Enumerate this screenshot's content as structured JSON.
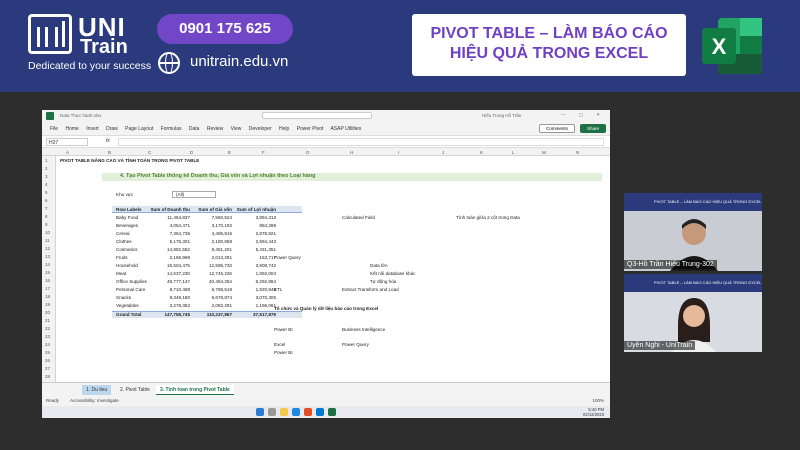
{
  "banner": {
    "brand": "UNI",
    "brand2": "Train",
    "tagline": "Dedicated to your success",
    "phone": "0901 175 625",
    "website": "unitrain.edu.vn",
    "title_line1": "PIVOT TABLE – LÀM BÁO CÁO",
    "title_line2": "HIỆU QUẢ TRONG EXCEL",
    "excel_letter": "X"
  },
  "excel": {
    "file_name": "Data Thực hành.xlsx",
    "user": "Hiếu Trung Hồ Trần",
    "window_controls": "— ▢ ✕",
    "ribbon_tabs": [
      "File",
      "Home",
      "Insert",
      "Draw",
      "Page Layout",
      "Formulas",
      "Data",
      "Review",
      "View",
      "Developer",
      "Help",
      "Power Pivot",
      "ASAP Utilities"
    ],
    "comments_label": "Comments",
    "share_label": "Share",
    "name_box": "H27",
    "fx": "fx",
    "columns": [
      "A",
      "B",
      "C",
      "D",
      "E",
      "F",
      "G",
      "H",
      "I",
      "J",
      "K",
      "L",
      "M",
      "N"
    ],
    "sheet_title": "PIVOT TABLE NÂNG CAO VÀ TÍNH TOÁN TRONG PIVOT TABLE",
    "banner_text": "4. Tạo Pivot Table thống kê Doanh thu, Giá vốn và Lợi nhuận theo Loại hàng",
    "filter_label": "Khu vực",
    "filter_value": "(All)",
    "pivot_headers": [
      "Row Labels",
      "Sum of Doanh thu",
      "Sum of Giá vốn",
      "Sum of Lợi nhuận"
    ],
    "pivot_rows": [
      [
        "Baby Food",
        "11,454,837",
        "7,560,524",
        "3,894,313"
      ],
      [
        "Beverages",
        "4,054,471",
        "3,170,182",
        "884,289"
      ],
      [
        "Cereal",
        "7,364,735",
        "4,485,915",
        "2,878,821"
      ],
      [
        "Clothes",
        "5,175,301",
        "2,180,858",
        "2,994,443"
      ],
      [
        "Cosmetics",
        "14,882,552",
        "9,451,201",
        "5,431,351"
      ],
      [
        "Fruits",
        "2,166,998",
        "2,013,281",
        "153,717"
      ],
      [
        "Household",
        "16,504,475",
        "12,595,733",
        "3,908,742"
      ],
      [
        "Meat",
        "14,637,230",
        "12,745,226",
        "1,892,004"
      ],
      [
        "Office Supplies",
        "49,777,147",
        "40,484,264",
        "9,292,884"
      ],
      [
        "Personal Care",
        "8,710,488",
        "6,789,519",
        "1,920,949"
      ],
      [
        "Snacks",
        "9,349,180",
        "6,678,874",
        "3,070,305"
      ],
      [
        "Vegetables",
        "3,278,352",
        "2,082,291",
        "1,196,061"
      ]
    ],
    "pivot_total": [
      "Grand Total",
      "147,755,745",
      "110,237,867",
      "37,517,879"
    ],
    "notes": {
      "calculated_field": "Calculated Field",
      "calc_between": "Tính toán giữa 2 cột trong Data",
      "power_query": "Power Query",
      "data_lon": "Data lớn",
      "ket_noi": "Kết nối database khác",
      "tu_dong": "Tự động hóa",
      "etl": "ETL",
      "etl_desc": "Extract Transform and Load",
      "to_chuc": "Tổ chức và Quản lý dữ liệu báo cáo trong Excel",
      "power_bi": "Power BI",
      "bi": "Business Intelligence",
      "excel": "Excel",
      "power_query2": "Power Query",
      "power_bi2": "Power BI"
    },
    "sheet_tabs": [
      "1. Du lieu",
      "2. Pivot Table",
      "3. Tinh toan trong Pivot Table"
    ],
    "status_ready": "Ready",
    "status_access": "Accessibility: Investigate",
    "zoom": "100%",
    "clock_time": "5:40 PM",
    "clock_date": "02/12/2023"
  },
  "video": {
    "participant1": "Q3-Hồ Trần Hiếu Trung-302",
    "participant2": "Uyên Nghi - UniTrain",
    "slide_caption": "PIVOT TABLE – LÀM BÁO CÁO HIỆU QUẢ TRONG EXCEL"
  }
}
